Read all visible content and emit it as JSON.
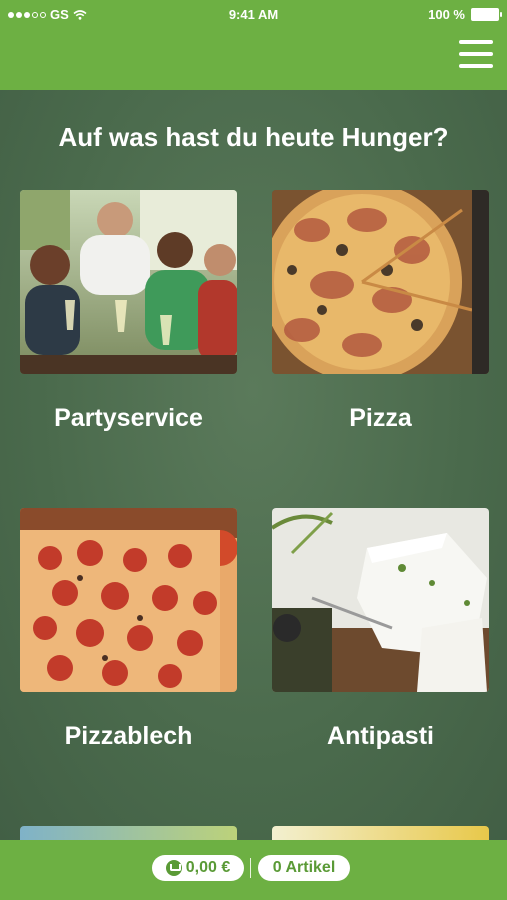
{
  "status": {
    "carrier": "GS",
    "time": "9:41 AM",
    "battery": "100 %"
  },
  "header": {
    "menu_icon": "hamburger-menu-icon"
  },
  "main": {
    "heading": "Auf was hast du heute Hunger?",
    "categories": [
      {
        "label": "Partyservice",
        "image": "party-photo"
      },
      {
        "label": "Pizza",
        "image": "pizza-photo"
      },
      {
        "label": "Pizzablech",
        "image": "tray-pizza-photo"
      },
      {
        "label": "Antipasti",
        "image": "feta-photo"
      }
    ]
  },
  "cart": {
    "price": "0,00 €",
    "items": "0 Artikel",
    "icon": "cart-icon"
  },
  "colors": {
    "brand_green": "#6db043",
    "content_bg": "#4d6a4d",
    "pill_text": "#5a9a36"
  }
}
